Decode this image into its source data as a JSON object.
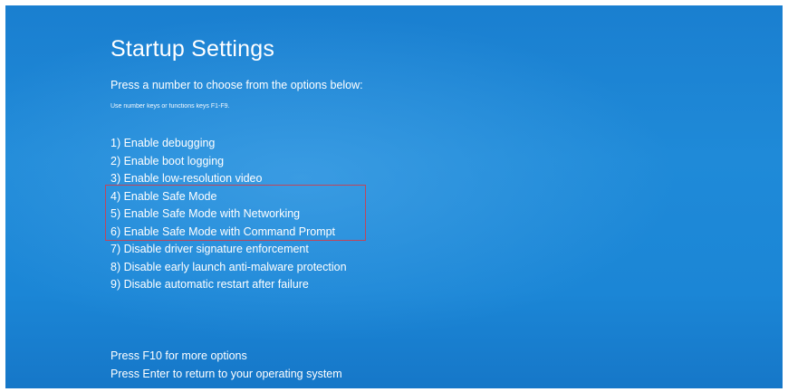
{
  "title": "Startup Settings",
  "subtitle": "Press a number to choose from the options below:",
  "hint": "Use number keys or functions keys F1-F9.",
  "options": [
    "1) Enable debugging",
    "2) Enable boot logging",
    "3) Enable low-resolution video",
    "4) Enable Safe Mode",
    "5) Enable Safe Mode with Networking",
    "6) Enable Safe Mode with Command Prompt",
    "7) Disable driver signature enforcement",
    "8) Disable early launch anti-malware protection",
    "9) Disable automatic restart after failure"
  ],
  "footer": {
    "more_options": "Press F10 for more options",
    "return": "Press Enter to return to your operating system"
  },
  "colors": {
    "background": "#1b86d6",
    "text": "#ffffff",
    "highlight_border": "#c0455a"
  }
}
